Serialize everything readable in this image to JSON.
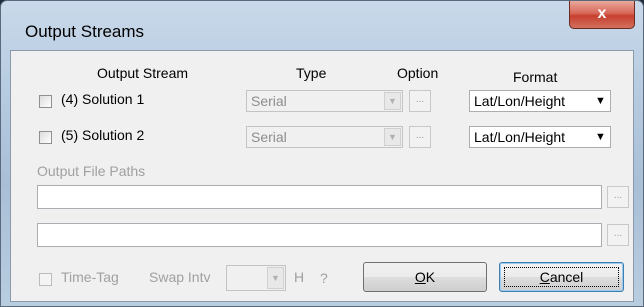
{
  "window": {
    "title": "Output Streams",
    "close_label": "x"
  },
  "headers": {
    "output_stream": "Output Stream",
    "type": "Type",
    "option": "Option",
    "format": "Format"
  },
  "streams": [
    {
      "label": "(4) Solution 1",
      "type": "Serial",
      "option": "...",
      "format": "Lat/Lon/Height"
    },
    {
      "label": "(5) Solution 2",
      "type": "Serial",
      "option": "...",
      "format": "Lat/Lon/Height"
    }
  ],
  "paths": {
    "label": "Output File Paths",
    "browse": "..."
  },
  "bottom": {
    "time_tag": "Time-Tag",
    "swap_intv": "Swap Intv",
    "swap_value": "",
    "unit": "H",
    "help": "?"
  },
  "buttons": {
    "ok_key": "O",
    "ok_rest": "K",
    "cancel_key": "C",
    "cancel_rest": "ancel"
  }
}
